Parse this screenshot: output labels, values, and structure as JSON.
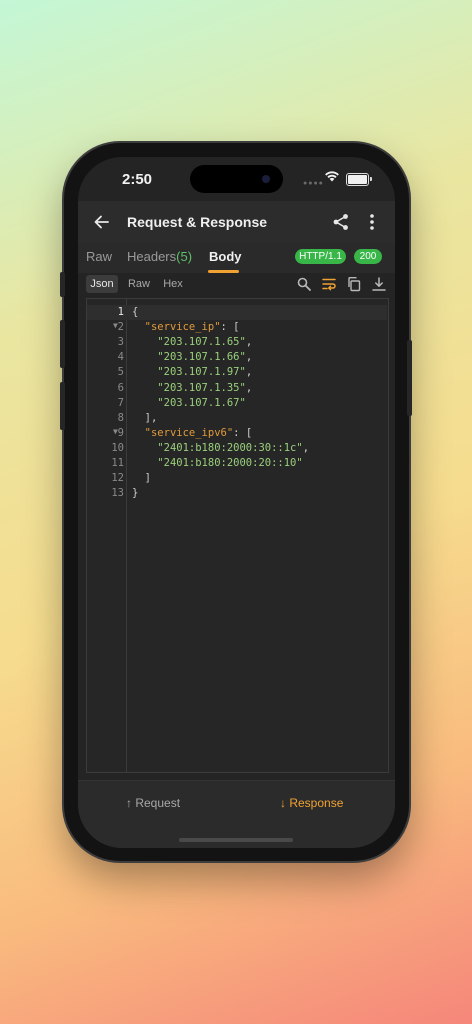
{
  "status_bar": {
    "time": "2:50",
    "icons": [
      "cellular-icon",
      "wifi-icon",
      "battery-icon"
    ]
  },
  "app_bar": {
    "title": "Request & Response",
    "back_icon": "arrow-left-icon",
    "share_icon": "share-icon",
    "more_icon": "more-vertical-icon"
  },
  "tabs": {
    "raw": "Raw",
    "headers": "Headers",
    "headers_count": "(5)",
    "body": "Body",
    "active": "Body",
    "protocol_badge": "HTTP/1.1",
    "status_badge": "200"
  },
  "format_tabs": {
    "json": "Json",
    "raw": "Raw",
    "hex": "Hex",
    "active": "Json"
  },
  "tools": [
    "search-icon",
    "wrap-text-icon",
    "copy-icon",
    "download-icon"
  ],
  "editor": {
    "lines": [
      {
        "num": "1",
        "parts": [
          [
            "p",
            "{"
          ]
        ]
      },
      {
        "num": "2",
        "parts": [
          [
            "p",
            "  "
          ],
          [
            "k",
            "\"service_ip\""
          ],
          [
            "p",
            ": ["
          ]
        ]
      },
      {
        "num": "3",
        "parts": [
          [
            "p",
            "    "
          ],
          [
            "s",
            "\"203.107.1.65\""
          ],
          [
            "p",
            ","
          ]
        ]
      },
      {
        "num": "4",
        "parts": [
          [
            "p",
            "    "
          ],
          [
            "s",
            "\"203.107.1.66\""
          ],
          [
            "p",
            ","
          ]
        ]
      },
      {
        "num": "5",
        "parts": [
          [
            "p",
            "    "
          ],
          [
            "s",
            "\"203.107.1.97\""
          ],
          [
            "p",
            ","
          ]
        ]
      },
      {
        "num": "6",
        "parts": [
          [
            "p",
            "    "
          ],
          [
            "s",
            "\"203.107.1.35\""
          ],
          [
            "p",
            ","
          ]
        ]
      },
      {
        "num": "7",
        "parts": [
          [
            "p",
            "    "
          ],
          [
            "s",
            "\"203.107.1.67\""
          ]
        ]
      },
      {
        "num": "8",
        "parts": [
          [
            "p",
            "  ],"
          ]
        ]
      },
      {
        "num": "9",
        "parts": [
          [
            "p",
            "  "
          ],
          [
            "k",
            "\"service_ipv6\""
          ],
          [
            "p",
            ": ["
          ]
        ]
      },
      {
        "num": "10",
        "parts": [
          [
            "p",
            "    "
          ],
          [
            "s",
            "\"2401:b180:2000:30::1c\""
          ],
          [
            "p",
            ","
          ]
        ]
      },
      {
        "num": "11",
        "parts": [
          [
            "p",
            "    "
          ],
          [
            "s",
            "\"2401:b180:2000:20::10\""
          ]
        ]
      },
      {
        "num": "12",
        "parts": [
          [
            "p",
            "  ]"
          ]
        ]
      },
      {
        "num": "13",
        "parts": [
          [
            "p",
            "}"
          ]
        ]
      }
    ],
    "fold_lines": [
      "2",
      "9"
    ],
    "current_line": "1"
  },
  "bottom_tabs": {
    "request": "Request",
    "response": "Response",
    "active": "Response"
  },
  "colors": {
    "accent": "#f0a233",
    "badge_green": "#38b648",
    "json_key": "#e09a3c",
    "json_string": "#9ad07c"
  }
}
